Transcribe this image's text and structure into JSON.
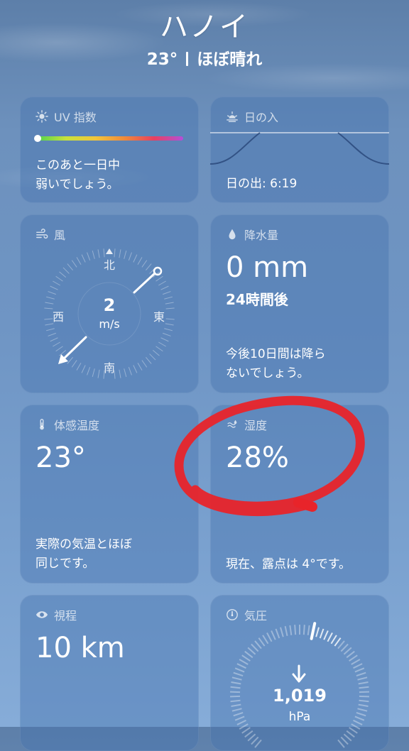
{
  "header": {
    "city": "ハノイ",
    "temp": "23°",
    "condition": "ほぼ晴れ"
  },
  "uv": {
    "title": "UV 指数",
    "desc_line1": "このあと一日中",
    "desc_line2": "弱いでしょう。",
    "icon": "sun-icon"
  },
  "sunset": {
    "title": "日の入",
    "sunrise_text": "日の出: 6:19",
    "icon": "sunset-icon"
  },
  "wind": {
    "title": "風",
    "speed": "2",
    "unit": "m/s",
    "north": "北",
    "south": "南",
    "east": "東",
    "west": "西",
    "icon": "wind-icon"
  },
  "rain": {
    "title": "降水量",
    "amount": "0 mm",
    "period": "24時間後",
    "desc_line1": "今後10日間は降ら",
    "desc_line2": "ないでしょう。",
    "icon": "raindrop-icon"
  },
  "feels": {
    "title": "体感温度",
    "value": "23°",
    "desc_line1": "実際の気温とほぼ",
    "desc_line2": "同じです。",
    "icon": "thermometer-icon"
  },
  "humidity": {
    "title": "湿度",
    "value": "28%",
    "desc": "現在、露点は 4°です。",
    "icon": "humidity-icon"
  },
  "visibility": {
    "title": "視程",
    "value": "10 km",
    "icon": "eye-icon"
  },
  "pressure": {
    "title": "気圧",
    "value": "1,019",
    "unit": "hPa",
    "icon": "gauge-icon"
  },
  "colors": {
    "annotation": "#e8242a"
  }
}
